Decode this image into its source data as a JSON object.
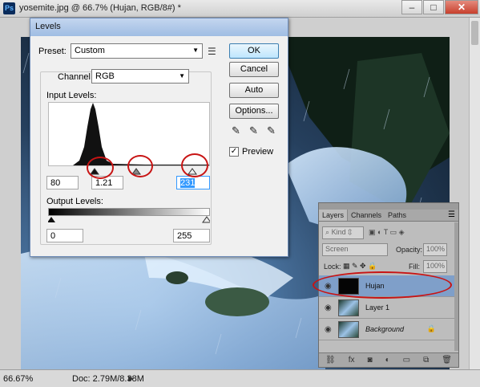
{
  "document": {
    "title": "yosemite.jpg @ 66.7% (Hujan, RGB/8#) *",
    "app_icon": "Ps",
    "window_buttons": [
      "–",
      "□",
      "✕"
    ],
    "zoom": "66.67%",
    "doc_size": "Doc: 2.79M/8.38M"
  },
  "levels": {
    "title": "Levels",
    "preset_label": "Preset:",
    "preset_value": "Custom",
    "channel_label": "Channel:",
    "channel_value": "RGB",
    "input_levels_label": "Input Levels:",
    "input_black": "80",
    "input_gamma": "1.21",
    "input_white": "231",
    "output_levels_label": "Output Levels:",
    "output_black": "0",
    "output_white": "255",
    "buttons": {
      "ok": "OK",
      "cancel": "Cancel",
      "auto": "Auto",
      "options": "Options..."
    },
    "preview_label": "Preview",
    "preview_checked": true
  },
  "layers_panel": {
    "tabs": [
      "Layers",
      "Channels",
      "Paths"
    ],
    "kind_label": "Kind",
    "blend_mode": "Screen",
    "opacity_label": "Opacity:",
    "opacity_value": "100%",
    "lock_label": "Lock:",
    "fill_label": "Fill:",
    "fill_value": "100%",
    "layers": [
      {
        "name": "Hujan",
        "selected": true
      },
      {
        "name": "Layer 1",
        "selected": false
      },
      {
        "name": "Background",
        "selected": false,
        "locked": true
      }
    ],
    "bottom_icons": [
      "link-icon",
      "fx-icon",
      "mask-icon",
      "adjustment-icon",
      "group-icon",
      "new-layer-icon",
      "trash-icon"
    ]
  },
  "colors": {
    "highlight_ring": "#c81414",
    "selected_layer": "#7f9fc9",
    "ok_button": "#bee6fd"
  }
}
